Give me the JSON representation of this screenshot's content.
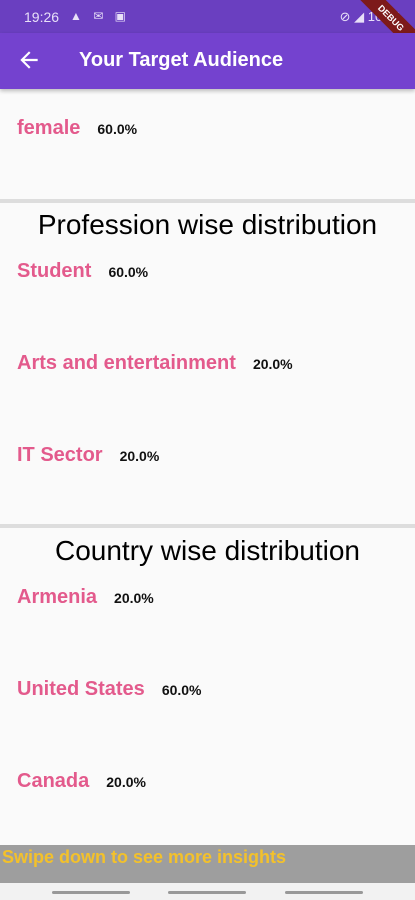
{
  "status": {
    "time": "19:26",
    "left_icons": "▲ ✉ ▣",
    "right_text": "⊘ ◢ 100%"
  },
  "debug_label": "DEBUG",
  "app_bar": {
    "title": "Your Target Audience",
    "back_icon": "arrow-back-icon"
  },
  "gender": {
    "items": [
      {
        "label": "female",
        "value": "60.0%"
      }
    ]
  },
  "profession": {
    "title": "Profession wise distribution",
    "items": [
      {
        "label": "Student",
        "value": "60.0%"
      },
      {
        "label": "Arts and entertainment",
        "value": "20.0%"
      },
      {
        "label": "IT Sector",
        "value": "20.0%"
      }
    ]
  },
  "country": {
    "title": "Country wise distribution",
    "items": [
      {
        "label": "Armenia",
        "value": "20.0%"
      },
      {
        "label": "United States",
        "value": "60.0%"
      },
      {
        "label": "Canada",
        "value": "20.0%"
      }
    ]
  },
  "banner": {
    "text": "Swipe down to see more insights"
  },
  "colors": {
    "app_bar": "#7442cf",
    "label": "#e35a8c",
    "banner_text": "#f3c12b",
    "banner_bg": "#9e9e9e"
  }
}
